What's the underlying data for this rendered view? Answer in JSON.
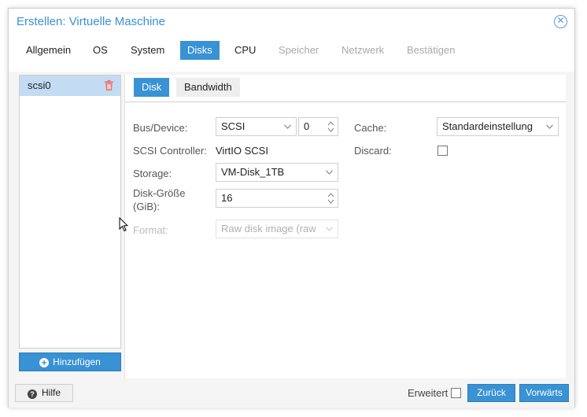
{
  "dialog": {
    "title": "Erstellen: Virtuelle Maschine"
  },
  "tabs": [
    {
      "label": "Allgemein",
      "state": "normal"
    },
    {
      "label": "OS",
      "state": "normal"
    },
    {
      "label": "System",
      "state": "normal"
    },
    {
      "label": "Disks",
      "state": "active"
    },
    {
      "label": "CPU",
      "state": "normal"
    },
    {
      "label": "Speicher",
      "state": "disabled"
    },
    {
      "label": "Netzwerk",
      "state": "disabled"
    },
    {
      "label": "Bestätigen",
      "state": "disabled"
    }
  ],
  "disk_list": {
    "items": [
      {
        "label": "scsi0",
        "selected": true
      }
    ],
    "add_label": "Hinzufügen"
  },
  "subtabs": [
    {
      "label": "Disk",
      "active": true
    },
    {
      "label": "Bandwidth",
      "active": false
    }
  ],
  "form": {
    "bus_device": {
      "label": "Bus/Device:",
      "bus": "SCSI",
      "device": "0"
    },
    "scsi_controller": {
      "label": "SCSI Controller:",
      "value": "VirtIO SCSI"
    },
    "storage": {
      "label": "Storage:",
      "value": "VM-Disk_1TB"
    },
    "disk_size": {
      "label_line1": "Disk-Größe",
      "label_line2": "(GiB):",
      "value": "16"
    },
    "format": {
      "label": "Format:",
      "value": "Raw disk image (raw",
      "disabled": true
    },
    "cache": {
      "label": "Cache:",
      "value": "Standardeinstellung"
    },
    "discard": {
      "label": "Discard:",
      "checked": false
    }
  },
  "footer": {
    "help_label": "Hilfe",
    "advanced_label": "Erweitert",
    "advanced_checked": false,
    "back_label": "Zurück",
    "next_label": "Vorwärts"
  },
  "colors": {
    "accent": "#3892d4",
    "selected_row": "#c3dcf3",
    "trash": "#e57373"
  }
}
